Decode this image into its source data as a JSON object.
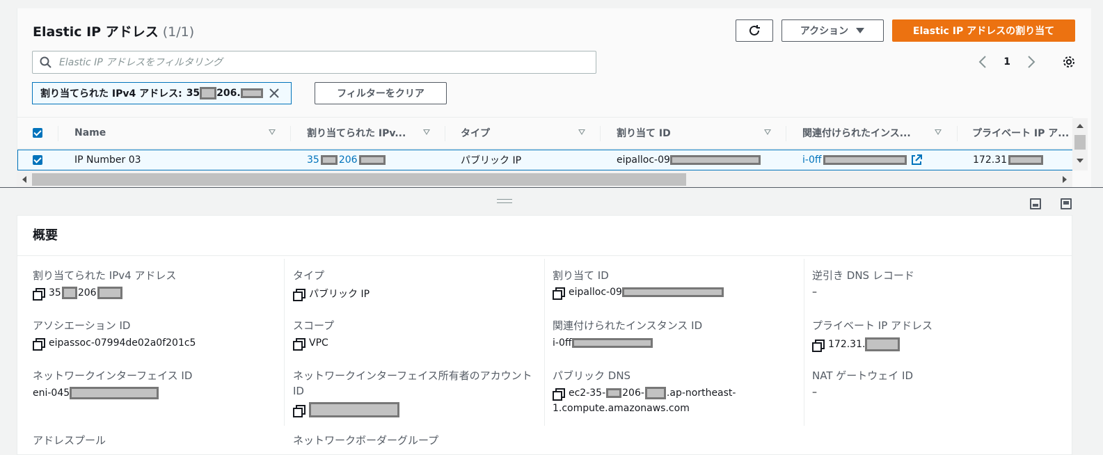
{
  "header": {
    "title": "Elastic IP アドレス",
    "count": "(1/1)",
    "action_label": "アクション",
    "allocate_label": "Elastic IP アドレスの割り当て"
  },
  "search": {
    "placeholder": "Elastic IP アドレスをフィルタリング"
  },
  "pagination": {
    "page": "1"
  },
  "filter": {
    "chip_label": "割り当てられた IPv4 アドレス:",
    "chip_value_prefix": "35",
    "chip_value_mid": "206.",
    "clear_label": "フィルターをクリア"
  },
  "table": {
    "columns": [
      "Name",
      "割り当てられた IPv...",
      "タイプ",
      "割り当て ID",
      "関連付けられたインス...",
      "プライベート IP ア..."
    ],
    "row": {
      "name": "IP Number 03",
      "ip_prefix": "35",
      "ip_mid": "206",
      "type": "パブリック IP",
      "allocation_id": "eipalloc-09",
      "instance_id": "i-0ff",
      "private_ip": "172.31"
    }
  },
  "details": {
    "title": "概要",
    "col1": [
      {
        "label": "割り当てられた IPv4 アドレス",
        "v1": "35",
        "v2": "206"
      },
      {
        "label": "アソシエーション ID",
        "value": "eipassoc-07994de02a0f201c5"
      },
      {
        "label": "ネットワークインターフェイス ID",
        "value": "eni-045"
      },
      {
        "label": "アドレスプール"
      }
    ],
    "col2": [
      {
        "label": "タイプ",
        "value": "パブリック IP"
      },
      {
        "label": "スコープ",
        "value": "VPC"
      },
      {
        "label": "ネットワークインターフェイス所有者のアカウント ID"
      },
      {
        "label": "ネットワークボーダーグループ"
      }
    ],
    "col3": [
      {
        "label": "割り当て ID",
        "value": "eipalloc-09"
      },
      {
        "label": "関連付けられたインスタンス ID",
        "value": "i-0ff"
      },
      {
        "label": "パブリック DNS",
        "v1": "ec2-35-",
        "v2": "206-",
        "v3": ".ap-northeast-",
        "v4": "1.compute.amazonaws.com"
      }
    ],
    "col4": [
      {
        "label": "逆引き DNS レコード",
        "value": "–"
      },
      {
        "label": "プライベート IP アドレス",
        "value": "172.31."
      },
      {
        "label": "NAT ゲートウェイ ID",
        "value": "–"
      }
    ]
  },
  "colors": {
    "accent": "#0073bb",
    "primary_button": "#ec7211",
    "text": "#16191f",
    "muted": "#545b64"
  },
  "icons": [
    "refresh-icon",
    "caret-down-icon",
    "search-icon",
    "chevron-left-icon",
    "chevron-right-icon",
    "settings-icon",
    "close-icon",
    "sort-icon",
    "external-link-icon",
    "copy-icon",
    "scroll-up-icon",
    "scroll-down-icon",
    "scroll-left-icon",
    "scroll-right-icon",
    "panel-bottom-icon",
    "panel-split-icon"
  ]
}
